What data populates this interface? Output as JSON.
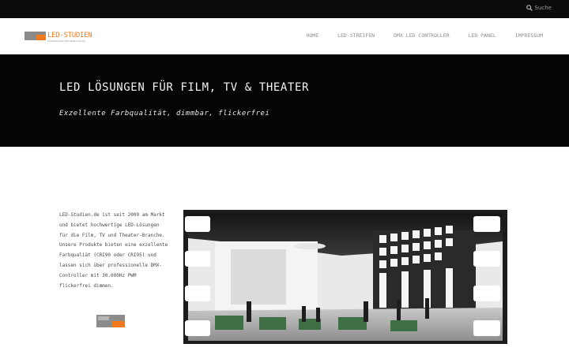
{
  "search": {
    "placeholder": "Suche",
    "icon": "search-icon"
  },
  "logo": {
    "title": "LED-STUDIEN",
    "subtitle": "professionelle LED-Beleuchtung"
  },
  "nav": {
    "items": [
      "HOME",
      "LED-STREIFEN",
      "DMX LED CONTROLLER",
      "LED PANEL",
      "IMPRESSUM"
    ]
  },
  "hero": {
    "title": "LED LÖSUNGEN FÜR FILM, TV & THEATER",
    "subtitle": "Exzellente Farbqualität, dimmbar, flickerfrei"
  },
  "intro": {
    "text": "LED-Studien.de ist seit 2009 am Markt und bietet hochwertige LED-Lösungen für die Film, TV und Theater-Branche. Unsere Produkte bieten eine exzellente Farbqualiät (CRI90 oder CRI95) und lassen sich über professionelle DMX-Controller mit 30.000Hz PWM flickerfrei dimmen."
  },
  "colors": {
    "accent": "#f07a1e",
    "dark": "#050505",
    "nav_text": "#8d8d8d"
  }
}
